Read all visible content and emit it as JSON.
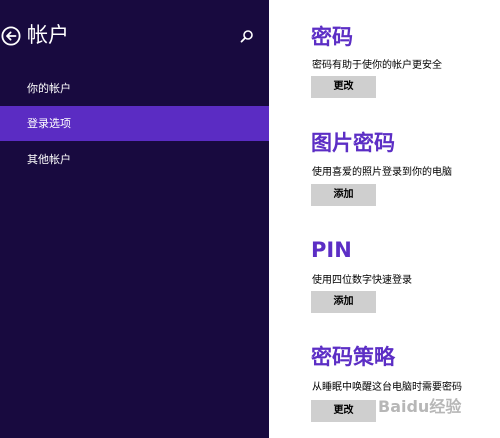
{
  "sidebar": {
    "title": "帐户",
    "items": [
      {
        "label": "你的帐户",
        "selected": false
      },
      {
        "label": "登录选项",
        "selected": true
      },
      {
        "label": "其他帐户",
        "selected": false
      }
    ]
  },
  "sections": {
    "password": {
      "title": "密码",
      "description": "密码有助于使你的帐户更安全",
      "button_label": "更改"
    },
    "picture_password": {
      "title": "图片密码",
      "description": "使用喜爱的照片登录到你的电脑",
      "button_label": "添加"
    },
    "pin": {
      "title": "PIN",
      "description": "使用四位数字快速登录",
      "button_label": "添加"
    },
    "password_policy": {
      "title": "密码策略",
      "description": "从睡眠中唤醒这台电脑时需要密码",
      "button_label": "更改"
    }
  },
  "watermark": {
    "text": "Baidu经验"
  },
  "colors": {
    "sidebar_bg": "#180a3f",
    "selected_item_bg": "#5b2cc3",
    "accent_title": "#5c2ec5",
    "button_bg": "#cfcfcf"
  },
  "icons": {
    "back": "back-arrow-circle-icon",
    "search": "search-icon"
  }
}
